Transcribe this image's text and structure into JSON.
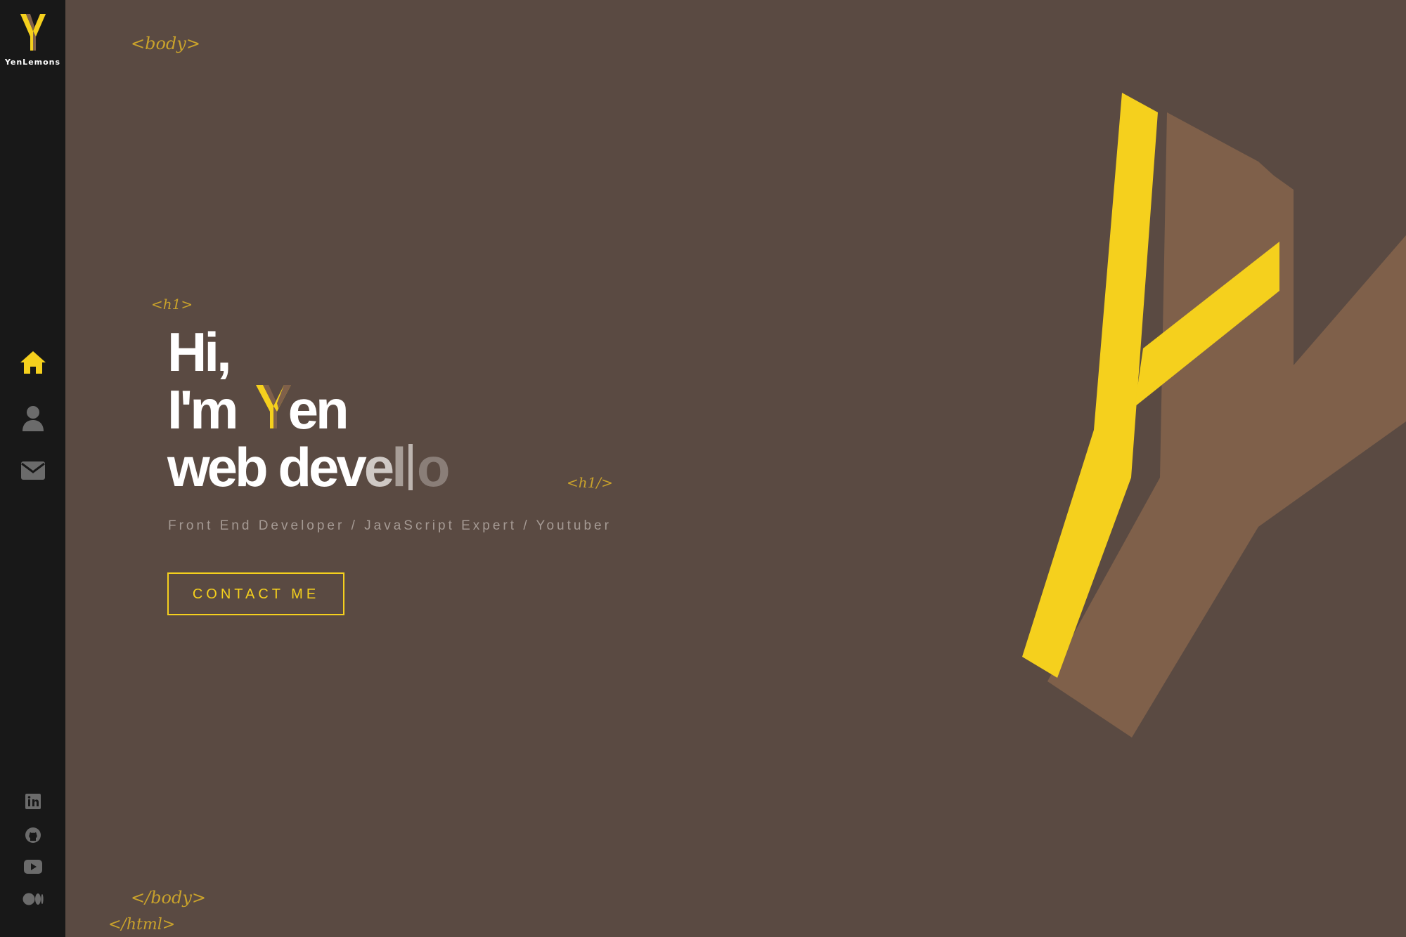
{
  "brand": {
    "logo_letter": "Y",
    "name": "YenLemons"
  },
  "nav": {
    "items": [
      {
        "name": "home",
        "icon": "home-icon",
        "active": true
      },
      {
        "name": "about",
        "icon": "user-icon",
        "active": false
      },
      {
        "name": "contact",
        "icon": "mail-icon",
        "active": false
      }
    ]
  },
  "social": {
    "items": [
      {
        "icon": "linkedin-icon"
      },
      {
        "icon": "github-icon"
      },
      {
        "icon": "youtube-icon"
      },
      {
        "icon": "medium-icon"
      }
    ]
  },
  "tags": {
    "body_open": "<body>",
    "h1_open": "<h1>",
    "h1_close": "<h1/>",
    "body_close": "</body>",
    "html_close": "</html>"
  },
  "hero": {
    "line1": "Hi,",
    "line2_prefix": "I'm",
    "line2_suffix": "en",
    "line3_solid": "web dev",
    "line3_fade1": "e",
    "line3_fade2": "l",
    "line3_fade3": "o",
    "subtitle": "Front End Developer / JavaScript Expert / Youtuber",
    "cta_label": "CONTACT ME"
  },
  "colors": {
    "background": "#5a4a42",
    "sidebar": "#181818",
    "accent": "#f5d01d",
    "brown": "#7f604a",
    "tag": "#c9a22b"
  }
}
